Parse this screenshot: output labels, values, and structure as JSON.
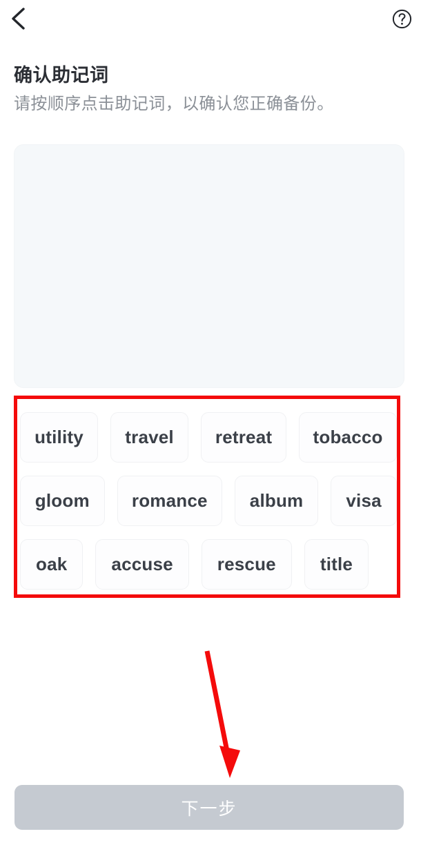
{
  "topbar": {
    "back_icon": "chevron-left-icon",
    "help_icon": "question-mark-circle-icon"
  },
  "header": {
    "title": "确认助记词",
    "subtitle": "请按顺序点击助记词，以确认您正确备份。"
  },
  "answer_panel": {
    "selected_words": [],
    "empty": true
  },
  "word_bank": {
    "rows": [
      [
        "utility",
        "travel",
        "retreat",
        "tobacco"
      ],
      [
        "gloom",
        "romance",
        "album",
        "visa"
      ],
      [
        "oak",
        "accuse",
        "rescue",
        "title"
      ]
    ],
    "words": [
      "utility",
      "travel",
      "retreat",
      "tobacco",
      "gloom",
      "romance",
      "album",
      "visa",
      "oak",
      "accuse",
      "rescue",
      "title"
    ]
  },
  "footer": {
    "next_label": "下一步",
    "next_enabled": false
  },
  "annotations": {
    "highlight_color": "#f40b0b",
    "arrow_color": "#f40b0b"
  },
  "colors": {
    "title_text": "#2b2e34",
    "subtitle_text": "#8b9097",
    "panel_bg": "#f5f8fa",
    "chip_bg": "#fdfdfe",
    "chip_text": "#3b4048",
    "button_bg": "#c5cad1",
    "button_text": "#ffffff"
  }
}
